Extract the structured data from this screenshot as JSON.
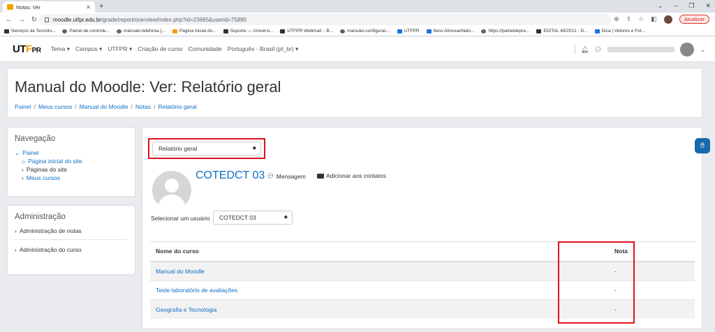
{
  "browser": {
    "tab_title": "Notas: Ver",
    "url_host": "moodle.utfpr.edu.br",
    "url_path": "/grade/report/overview/index.php?id=23665&userid=75880",
    "update_label": "Atualizar",
    "bookmarks": [
      "Serviços de Tecnolo...",
      "Painel de controle...",
      "manuais:telefonia [...",
      "Página inicial do...",
      "Suporte — Universi...",
      "UTFPR Webmail :: B...",
      "manuais:configurac...",
      "UTFPR",
      "Itens Almoxarifado...",
      "https://paineldepre...",
      "EDITAL 49/2021 - D...",
      "Dica | Vetores e Fot..."
    ]
  },
  "moodle_nav": {
    "logo_text": "UTFPR",
    "links": [
      "Tema ▾",
      "Campus ▾",
      "UTFPR ▾",
      "Criação de curso",
      "Comunidade",
      "Português - Brasil (pt_br) ▾"
    ]
  },
  "header": {
    "title": "Manual do Moodle: Ver: Relatório geral",
    "breadcrumb": [
      "Painel",
      "Meus cursos",
      "Manual do Moodle",
      "Notas",
      "Relatório geral"
    ]
  },
  "navigation_block": {
    "title": "Navegação",
    "painel": "Painel",
    "home": "Página inicial do site",
    "site_pages": "Páginas do site",
    "my_courses": "Meus cursos"
  },
  "admin_block": {
    "title": "Administração",
    "grades_admin": "Administração de notas",
    "course_admin": "Administração do curso"
  },
  "main": {
    "report_select": "Relatório geral",
    "user_name": "COTEDCT 03",
    "message": "Mensagem",
    "add_contact": "Adicionar aos contatos",
    "select_user_label": "Selecionar um usuário",
    "select_user_value": "COTEDCT 03",
    "table": {
      "col_course": "Nome do curso",
      "col_grade": "Nota",
      "rows": [
        {
          "course": "Manual do Moodle",
          "grade": "-"
        },
        {
          "course": "Teste laboratório de avaliações",
          "grade": "-"
        },
        {
          "course": "Geografia e Tecnologia",
          "grade": "-"
        }
      ]
    }
  },
  "colors": {
    "link": "#0f6fc5",
    "highlight_box": "#e0101a",
    "logo_accent": "#f4a000"
  }
}
